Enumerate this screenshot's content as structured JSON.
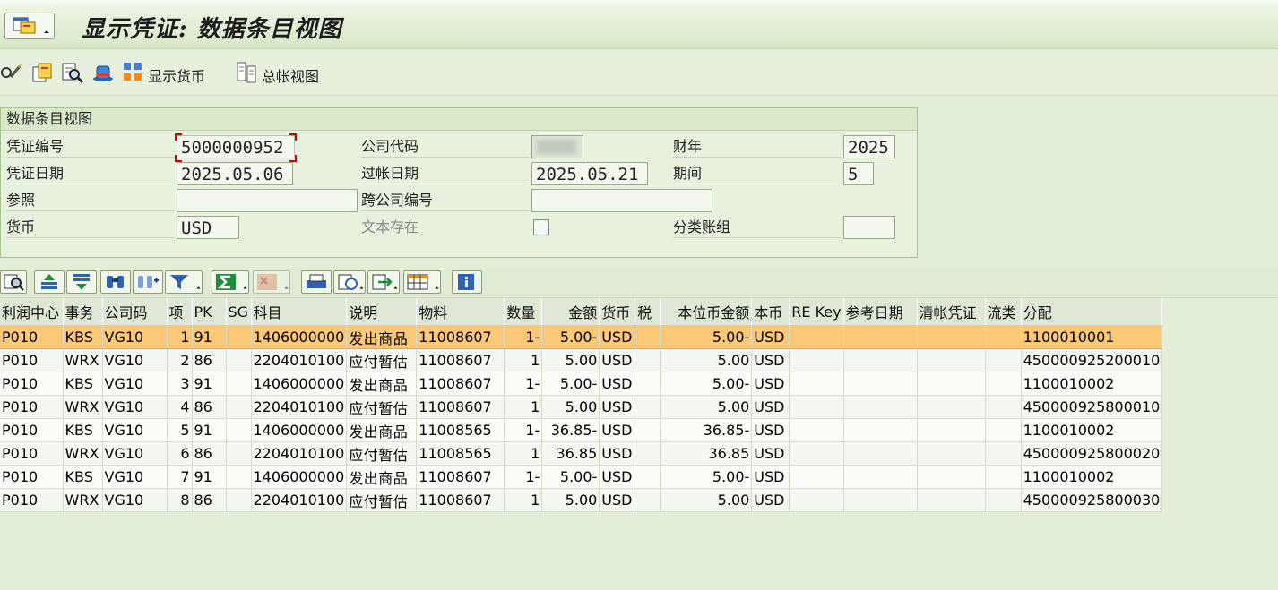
{
  "title": "显示凭证: 数据条目视图",
  "toolbar": {
    "display_currency": "显示货币",
    "general_ledger_view": "总帐视图"
  },
  "header": {
    "panel_title": "数据条目视图",
    "doc_number_label": "凭证编号",
    "doc_number": "5000000952",
    "company_code_label": "公司代码",
    "company_code": "",
    "fiscal_year_label": "财年",
    "fiscal_year": "2025",
    "doc_date_label": "凭证日期",
    "doc_date": "2025.05.06",
    "posting_date_label": "过帐日期",
    "posting_date": "2025.05.21",
    "period_label": "期间",
    "period": "5",
    "reference_label": "参照",
    "reference": "",
    "cross_company_label": "跨公司编号",
    "cross_company": "",
    "currency_label": "货币",
    "currency": "USD",
    "text_exists_label": "文本存在",
    "ledger_group_label": "分类账组",
    "ledger_group": ""
  },
  "grid": {
    "columns": [
      "利润中心",
      "事务",
      "公司码",
      "项",
      "PK",
      "SG",
      "科目",
      "说明",
      "物料",
      "数量",
      "金额",
      "货币",
      "税",
      "本位币金额",
      "本币",
      "RE Key",
      "参考日期",
      "清帐凭证",
      "流类",
      "分配"
    ],
    "rows": [
      [
        "P010",
        "KBS",
        "VG10",
        "1",
        "91",
        "",
        "1406000000",
        "发出商品",
        "11008607",
        "1-",
        "5.00-",
        "USD",
        "",
        "5.00-",
        "USD",
        "",
        "",
        "",
        "",
        "1100010001"
      ],
      [
        "P010",
        "WRX",
        "VG10",
        "2",
        "86",
        "",
        "2204010100",
        "应付暂估",
        "11008607",
        "1",
        "5.00",
        "USD",
        "",
        "5.00",
        "USD",
        "",
        "",
        "",
        "",
        "450000925200010"
      ],
      [
        "P010",
        "KBS",
        "VG10",
        "3",
        "91",
        "",
        "1406000000",
        "发出商品",
        "11008607",
        "1-",
        "5.00-",
        "USD",
        "",
        "5.00-",
        "USD",
        "",
        "",
        "",
        "",
        "1100010002"
      ],
      [
        "P010",
        "WRX",
        "VG10",
        "4",
        "86",
        "",
        "2204010100",
        "应付暂估",
        "11008607",
        "1",
        "5.00",
        "USD",
        "",
        "5.00",
        "USD",
        "",
        "",
        "",
        "",
        "450000925800010"
      ],
      [
        "P010",
        "KBS",
        "VG10",
        "5",
        "91",
        "",
        "1406000000",
        "发出商品",
        "11008565",
        "1-",
        "36.85-",
        "USD",
        "",
        "36.85-",
        "USD",
        "",
        "",
        "",
        "",
        "1100010002"
      ],
      [
        "P010",
        "WRX",
        "VG10",
        "6",
        "86",
        "",
        "2204010100",
        "应付暂估",
        "11008565",
        "1",
        "36.85",
        "USD",
        "",
        "36.85",
        "USD",
        "",
        "",
        "",
        "",
        "450000925800020"
      ],
      [
        "P010",
        "KBS",
        "VG10",
        "7",
        "91",
        "",
        "1406000000",
        "发出商品",
        "11008607",
        "1-",
        "5.00-",
        "USD",
        "",
        "5.00-",
        "USD",
        "",
        "",
        "",
        "",
        "1100010002"
      ],
      [
        "P010",
        "WRX",
        "VG10",
        "8",
        "86",
        "",
        "2204010100",
        "应付暂估",
        "11008607",
        "1",
        "5.00",
        "USD",
        "",
        "5.00",
        "USD",
        "",
        "",
        "",
        "",
        "450000925800030"
      ]
    ]
  },
  "colors": {
    "background": "#e3eed8",
    "selected_row": "#fbc877",
    "focus_marker": "#d00000"
  }
}
